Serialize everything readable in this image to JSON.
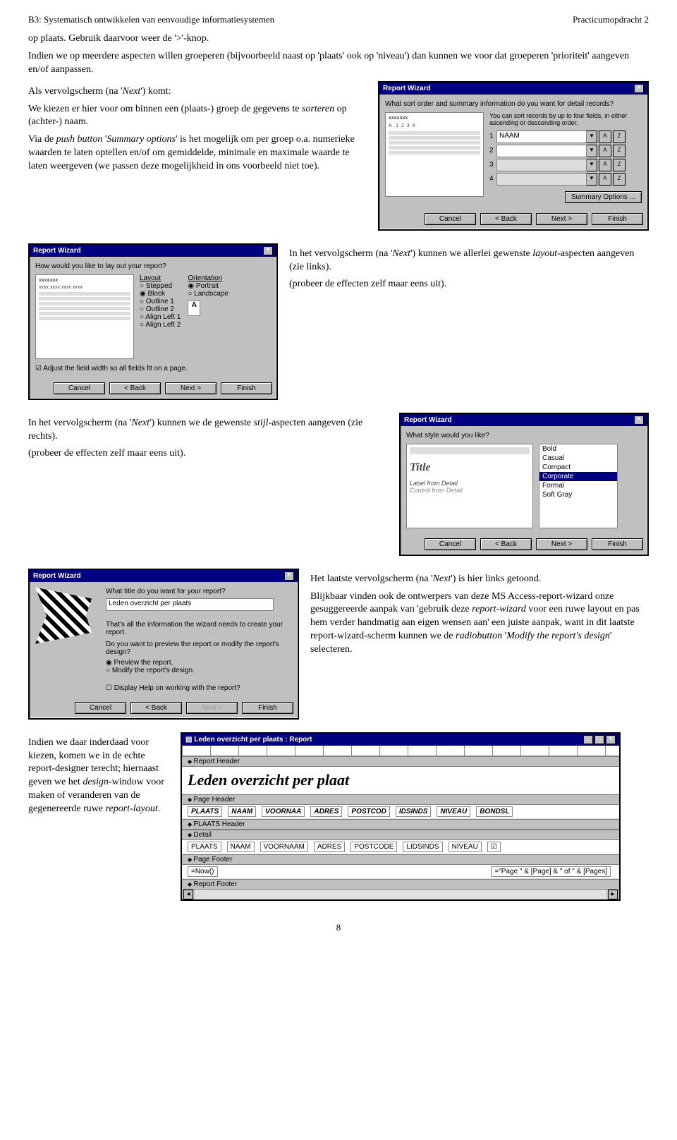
{
  "header": {
    "left": "B3: Systematisch ontwikkelen van eenvoudige informatiesystemen",
    "right": "Practicumopdracht 2"
  },
  "para1": "op plaats. Gebruik daarvoor weer de '>'-knop.",
  "para2": "Indien we op meerdere aspecten willen groeperen (bijvoorbeeld naast op 'plaats' ook op 'niveau') dan kunnen we voor dat groeperen 'prioriteit' aangeven en/of aanpassen.",
  "para3a": "Als vervolgscherm (na '",
  "para3i": "Next",
  "para3b": "') komt:",
  "para4a": "We kiezen er hier voor om binnen een (plaats-) groep de gegevens te ",
  "para4i": "sorteren",
  "para4b": " op (achter-) naam.",
  "para5a": "Via de ",
  "para5i1": "push button",
  "para5b": " '",
  "para5i2": "Summary options",
  "para5c": "' is het mogelijk om per groep o.a. numerieke waarden te laten optellen en/of om gemiddelde, minimale en maximale waarde te laten weergeven (we passen deze mogelijkheid in ons voorbeeld niet toe).",
  "wiz1": {
    "title": "Report Wizard",
    "q": "What sort order and summary information do you want for detail records?",
    "hint": "You can sort records by up to four fields, in either ascending or descending order.",
    "field1": "NAAM",
    "summary_btn": "Summary Options ...",
    "cancel": "Cancel",
    "back": "< Back",
    "next": "Next >",
    "finish": "Finish"
  },
  "para6a": "In het vervolgscherm (na '",
  "para6i1": "Next",
  "para6b": "') kunnen we allerlei gewenste ",
  "para6i2": "layout",
  "para6c": "-aspecten aangeven (zie links).",
  "para7": "(probeer de effecten zelf maar eens uit).",
  "wiz2": {
    "title": "Report Wizard",
    "q": "How would you like to lay out your report?",
    "layout_h": "Layout",
    "layouts": [
      "Stepped",
      "Block",
      "Outline 1",
      "Outline 2",
      "Align Left 1",
      "Align Left 2"
    ],
    "layout_sel": 1,
    "orient_h": "Orientation",
    "orients": [
      "Portrait",
      "Landscape"
    ],
    "orient_sel": 0,
    "fit": "Adjust the field width so all fields fit on a page.",
    "cancel": "Cancel",
    "back": "< Back",
    "next": "Next >",
    "finish": "Finish"
  },
  "para8a": "In het vervolgscherm (na '",
  "para8i1": "Next",
  "para8b": "') kunnen we de gewenste ",
  "para8i2": "stijl",
  "para8c": "-aspecten aangeven (zie rechts).",
  "para9": "(probeer de effecten zelf maar eens uit).",
  "wiz3": {
    "title": "Report Wizard",
    "q": "What style would you like?",
    "styles": [
      "Bold",
      "Casual",
      "Compact",
      "Corporate",
      "Formal",
      "Soft Gray"
    ],
    "style_sel": 3,
    "prev_title": "Title",
    "prev_label": "Label from Detail",
    "prev_ctrl": "Control from Detail",
    "cancel": "Cancel",
    "back": "< Back",
    "next": "Next >",
    "finish": "Finish"
  },
  "para10a": "Het laatste vervolgscherm (na '",
  "para10i": "Next",
  "para10b": "') is hier links getoond.",
  "para11a": "Blijkbaar vinden ook de ontwerpers van deze MS Access-report-wizard onze gesuggereerde aanpak van 'gebruik deze ",
  "para11i1": "report-wizard",
  "para11b": " voor een ruwe layout en pas hem verder handmatig aan eigen wensen aan' een juiste aanpak, want in dit laatste report-wizard-scherm kunnen we de ",
  "para11i2": "radiobutton",
  "para11c": " '",
  "para11i3": "Modify the report's design",
  "para11d": "' selecteren.",
  "wiz4": {
    "title": "Report Wizard",
    "q": "What title do you want for your report?",
    "title_val": "Leden overzicht per plaats",
    "t1": "That's all the information the wizard needs to create your report.",
    "t2": "Do you want to preview the report or modify the report's design?",
    "r1": "Preview the report.",
    "r2": "Modify the report's design.",
    "help": "Display Help on working with the report?",
    "cancel": "Cancel",
    "back": "< Back",
    "next": "Next >",
    "finish": "Finish"
  },
  "para12a": "Indien we daar inderdaad voor kiezen, komen we in de echte report-designer terecht; hiernaast geven we het ",
  "para12i": "design",
  "para12b": "-window voor maken of veranderen van de gegenereerde ruwe ",
  "para12i2": "report-layout",
  "para12c": ".",
  "designer": {
    "title": "Leden overzicht per plaats : Report",
    "bands": {
      "rh": "Report Header",
      "ph": "Page Header",
      "gh": "PLAATS Header",
      "dt": "Detail",
      "pf": "Page Footer",
      "rf": "Report Footer"
    },
    "big_title": "Leden overzicht per plaat",
    "page_hdr": [
      "PLAATS",
      "NAAM",
      "VOORNAA",
      "ADRES",
      "POSTCOD",
      "IDSINDS",
      "NIVEAU",
      "BONDSL"
    ],
    "detail": [
      "PLAATS",
      "NAAM",
      "VOORNAAM",
      "ADRES",
      "POSTCODE",
      "LIDSINDS",
      "NIVEAU",
      "☑"
    ],
    "foot_left": "=Now()",
    "foot_right": "=\"Page \" & [Page] & \" of \" & [Pages]"
  },
  "page_num": "8"
}
